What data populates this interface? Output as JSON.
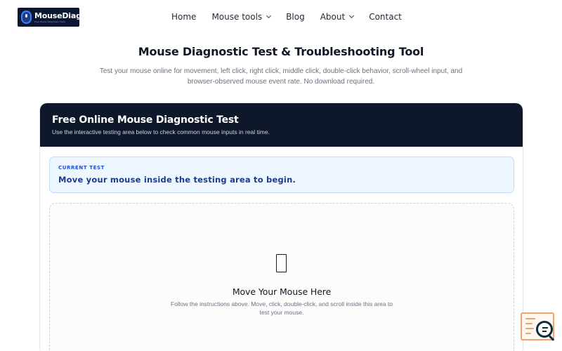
{
  "header": {
    "logo_text": "MouseDiag",
    "logo_tagline": "Free Mouse Diagnostic Tools",
    "nav": [
      {
        "label": "Home",
        "dropdown": false
      },
      {
        "label": "Mouse tools",
        "dropdown": true
      },
      {
        "label": "Blog",
        "dropdown": false
      },
      {
        "label": "About",
        "dropdown": true
      },
      {
        "label": "Contact",
        "dropdown": false
      }
    ]
  },
  "hero": {
    "title": "Mouse Diagnostic Test & Troubleshooting Tool",
    "subtitle": "Test your mouse online for movement, left click, right click, middle click, double-click behavior, scroll-wheel input, and browser-observed mouse event rate. No download required."
  },
  "card": {
    "title": "Free Online Mouse Diagnostic Test",
    "description": "Use the interactive testing area below to check common mouse inputs in real time.",
    "current_test": {
      "label": "CURRENT TEST",
      "instruction": "Move your mouse inside the testing area to begin."
    },
    "test_area": {
      "icon": "mouse-icon",
      "title": "Move Your Mouse Here",
      "subtitle": "Follow the instructions above. Move, click, double-click, and scroll inside this area to test your mouse."
    }
  },
  "floating_widget": {
    "icon": "search-console-icon"
  },
  "colors": {
    "header_dark": "#0f172a",
    "accent_blue": "#1e3a8a",
    "current_test_bg": "#eef6ff",
    "widget_orange": "#f3a06b"
  }
}
